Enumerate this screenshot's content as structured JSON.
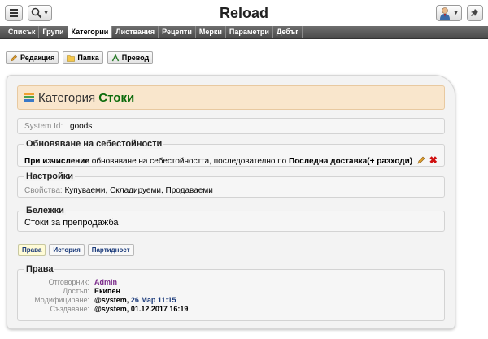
{
  "app": {
    "title": "Reload"
  },
  "tabs": [
    {
      "label": "Списък"
    },
    {
      "label": "Групи"
    },
    {
      "label": "Категории",
      "active": true
    },
    {
      "label": "Листвания"
    },
    {
      "label": "Рецепти"
    },
    {
      "label": "Мерки"
    },
    {
      "label": "Параметри"
    },
    {
      "label": "Дебъг"
    }
  ],
  "actions": [
    {
      "label": "Редакция",
      "icon": "pencil-icon"
    },
    {
      "label": "Папка",
      "icon": "folder-icon"
    },
    {
      "label": "Превод",
      "icon": "translate-icon"
    }
  ],
  "category": {
    "prefix": "Категория",
    "name": "Стоки",
    "system_id_label": "System Id:",
    "system_id": "goods"
  },
  "cost": {
    "legend": "Обновяване на себестойности",
    "when_label": "При изчисление",
    "text": " обновяване на себестойността, последователно по ",
    "method": "Последна доставка(+ разходи)"
  },
  "settings": {
    "legend": "Настройки",
    "props_label": "Свойства",
    "props_value": "Купуваеми, Складируеми, Продаваеми"
  },
  "notes": {
    "legend": "Бележки",
    "text": "Стоки за препродажба"
  },
  "subtabs": [
    {
      "label": "Права",
      "active": true
    },
    {
      "label": "История"
    },
    {
      "label": "Партидност"
    }
  ],
  "rights": {
    "legend": "Права",
    "rows": [
      {
        "key": "Отговорник:",
        "value": "Admin"
      },
      {
        "key": "Достъп:",
        "value": "Екипен"
      },
      {
        "key": "Модифициране:",
        "value_user": "@system",
        "value_date": "26 Мар 11:15"
      },
      {
        "key": "Създаване:",
        "value_user": "@system",
        "value_date": "01.12.2017 16:19"
      }
    ]
  },
  "colors": {
    "accent_green": "#0b6b0b",
    "header_bg": "#f9e6cc",
    "tabbar_bg": "#5a5a5a",
    "delete_red": "#d01010"
  }
}
